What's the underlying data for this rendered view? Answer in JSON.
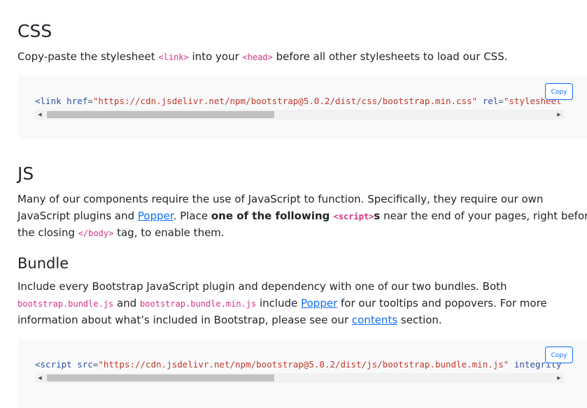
{
  "css_section": {
    "heading": "CSS",
    "desc": {
      "t1": "Copy-paste the stylesheet ",
      "c1": "<link>",
      "t2": " into your ",
      "c2": "<head>",
      "t3": " before all other stylesheets to load our CSS."
    },
    "code": {
      "open": "<link",
      "attr1": " href",
      "eq1": "=",
      "val1": "\"https://cdn.jsdelivr.net/npm/bootstrap@5.0.2/dist/css/bootstrap.min.css\"",
      "attr2": " rel",
      "eq2": "=",
      "val2": "\"stylesheet\""
    },
    "copy_label": "Copy",
    "scroll_fraction": 0.45
  },
  "js_section": {
    "heading": "JS",
    "desc": {
      "l1": "Many of our components require the use of JavaScript to function. Specifically, they require our own",
      "l2a": "JavaScript plugins and ",
      "l2link": "Popper",
      "l2b": ". Place ",
      "l2strong": "one of the following ",
      "l2code": "<script>",
      "l2strong2": "s",
      "l2c": " near the end of your pages, right before",
      "l3a": "the closing ",
      "l3code": "</body>",
      "l3b": " tag, to enable them."
    }
  },
  "bundle_section": {
    "heading": "Bundle",
    "desc": {
      "l1": "Include every Bootstrap JavaScript plugin and dependency with one of our two bundles. Both",
      "l2code1": "bootstrap.bundle.js",
      "l2a": " and ",
      "l2code2": "bootstrap.bundle.min.js",
      "l2b": " include ",
      "l2link": "Popper",
      "l2c": " for our tooltips and popovers. For more",
      "l3a": "information about what’s included in Bootstrap, please see our ",
      "l3link": "contents",
      "l3b": " section."
    },
    "code": {
      "open": "<script",
      "attr1": " src",
      "eq1": "=",
      "val1": "\"https://cdn.jsdelivr.net/npm/bootstrap@5.0.2/dist/js/bootstrap.bundle.min.js\"",
      "attr2": " integrity"
    },
    "copy_label": "Copy",
    "scroll_fraction": 0.45
  },
  "icons": {
    "scroll_left": "◀",
    "scroll_right": "▶"
  }
}
